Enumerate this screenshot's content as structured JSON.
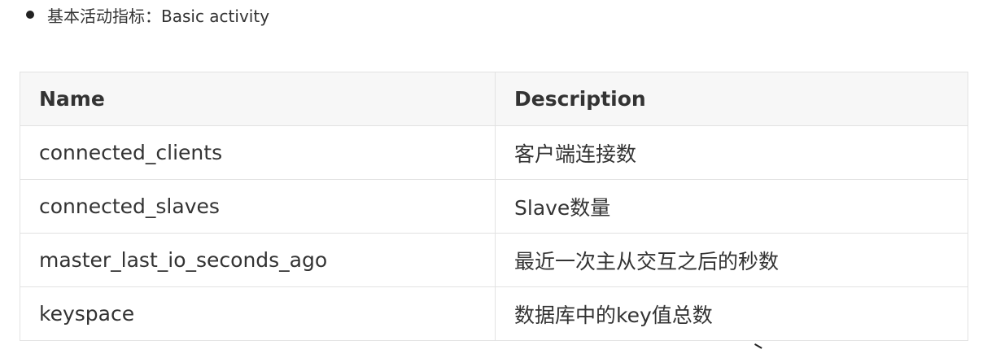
{
  "heading": {
    "text": "基本活动指标：Basic activity"
  },
  "table": {
    "headers": {
      "name": "Name",
      "description": "Description"
    },
    "rows": [
      {
        "name": "connected_clients",
        "description": "客户端连接数"
      },
      {
        "name": "connected_slaves",
        "description": "Slave数量"
      },
      {
        "name": "master_last_io_seconds_ago",
        "description": "最近一次主从交互之后的秒数"
      },
      {
        "name": "keyspace",
        "description": "数据库中的key值总数"
      }
    ]
  }
}
